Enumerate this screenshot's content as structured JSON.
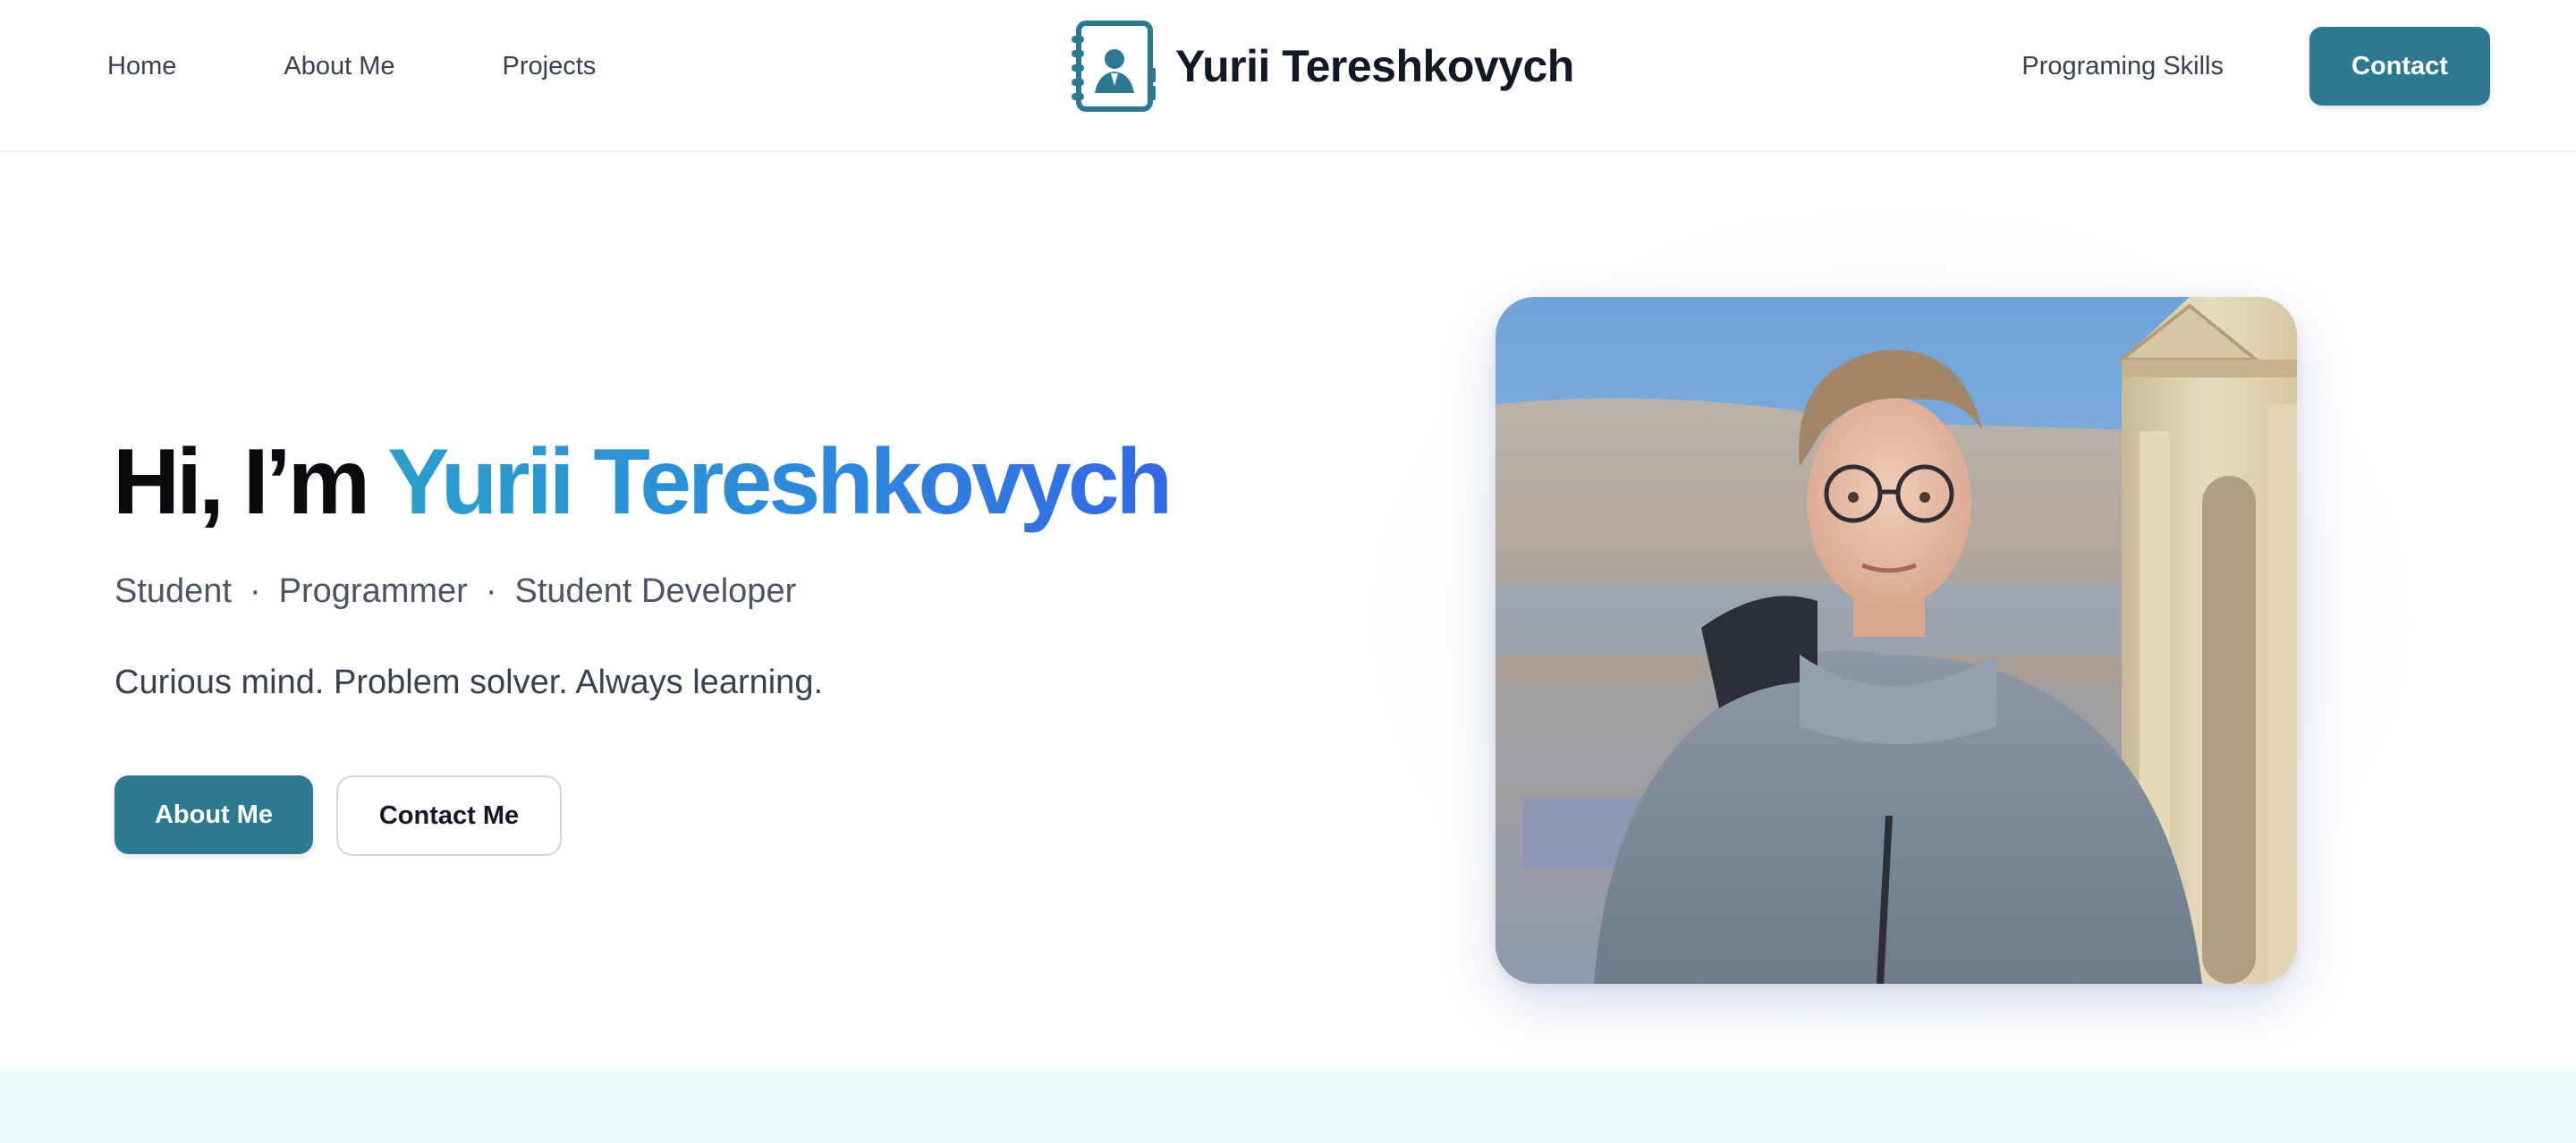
{
  "nav": {
    "links_left": [
      "Home",
      "About Me",
      "Projects"
    ],
    "brand": "Yurii Tereshkovych",
    "logo_icon": "contact-book-icon",
    "link_right": "Programing Skills",
    "contact_label": "Contact"
  },
  "hero": {
    "title_prefix": "Hi, I’m",
    "title_name": "Yurii Tereshkovych",
    "roles": [
      "Student",
      "Programmer",
      "Student Developer"
    ],
    "role_separator": "·",
    "tagline": "Curious mind. Problem solver. Always learning.",
    "primary_button": "About Me",
    "secondary_button": "Contact Me",
    "photo": "profile-photo"
  },
  "colors": {
    "accent": "#2b7a92",
    "name_gradient_start": "#2a9fcb",
    "name_gradient_end": "#3466e6",
    "next_section_bg": "#eefbfc"
  }
}
